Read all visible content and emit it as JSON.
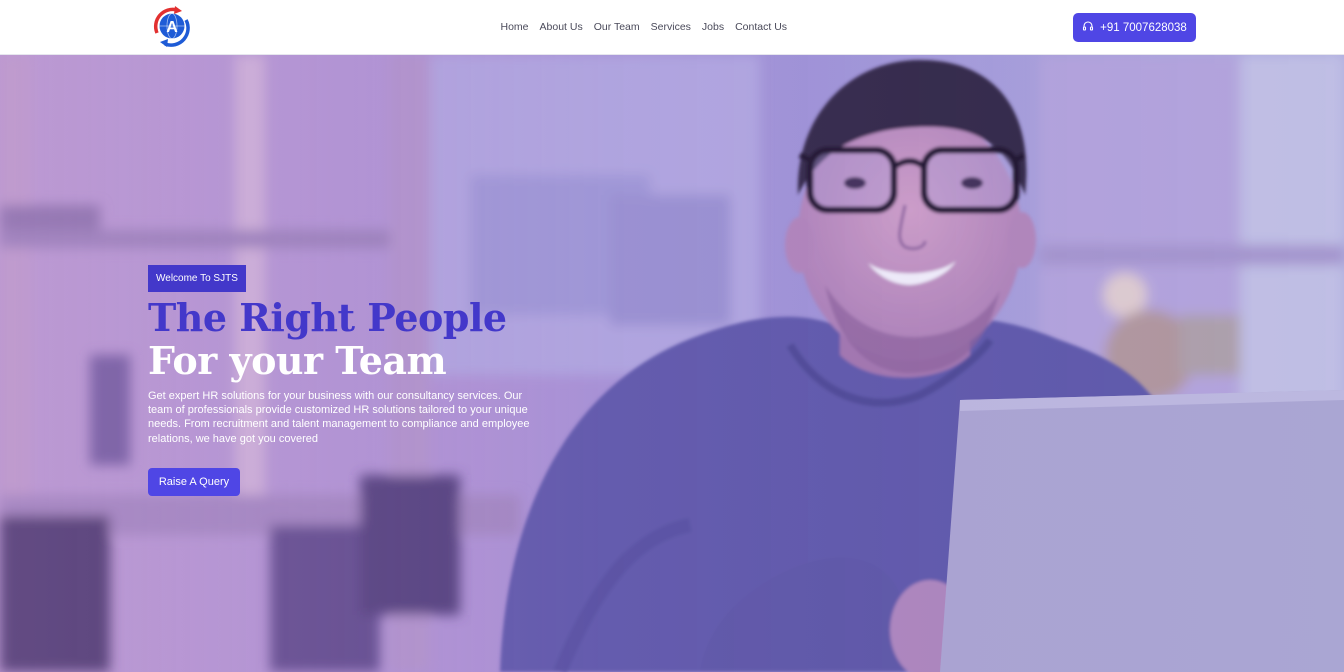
{
  "header": {
    "nav": [
      "Home",
      "About Us",
      "Our Team",
      "Services",
      "Jobs",
      "Contact Us"
    ],
    "phone_label": "+91 7007628038"
  },
  "hero": {
    "badge": "Welcome To SJTS",
    "title_line1": "The Right People",
    "title_line2": "For your Team",
    "description": "Get expert HR solutions for your business with our consultancy services. Our team of professionals provide customized HR solutions tailored to your unique needs. From recruitment and talent management to compliance and employee relations, we have got you covered",
    "cta_label": "Raise A Query"
  },
  "icons": {
    "logo": "globe-logo-icon",
    "phone": "headphones-icon"
  },
  "colors": {
    "primary": "#4f46e5",
    "title_accent": "#4338ca",
    "logo_blue": "#1e5bd6",
    "logo_red": "#e23030"
  }
}
